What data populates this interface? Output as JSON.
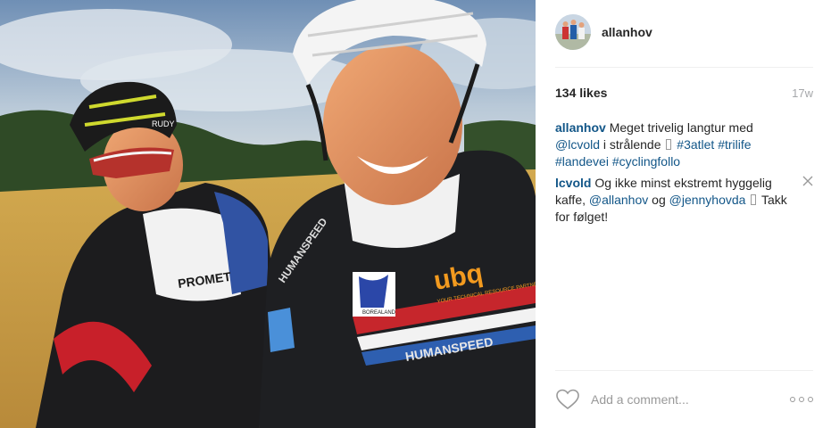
{
  "post": {
    "username": "allanhov",
    "likes": "134 likes",
    "age": "17w"
  },
  "caption": {
    "user": "allanhov",
    "text1": "Meget trivelig langtur med",
    "mention": "@lcvold",
    "text2": "i strålende",
    "tag1": "#3atlet",
    "tag2": "#trilife",
    "tag3": "#landevei",
    "tag4": "#cyclingfollo"
  },
  "comment": {
    "user": "lcvold",
    "text1": "Og ikke minst ekstremt hyggelig kaffe,",
    "mention1": "@allanhov",
    "text2": "og",
    "mention2": "@jennyhovda",
    "text3": "Takk for følget!"
  },
  "footer": {
    "placeholder": "Add a comment..."
  },
  "photo_text": {
    "helmet_brand": "RUDY",
    "jersey_left_1": "HUMANSPEED",
    "jersey_right_1": "ubq",
    "jersey_right_2": "YOUR TECHNICAL RESOURCE PARTNER",
    "jersey_right_3": "HUMANSPEED",
    "jersey_right_4": "BOREALAND",
    "jersey_left_2": "PROMET"
  },
  "colors": {
    "link": "#125688",
    "muted": "#a5a7aa",
    "divider": "#efefef"
  }
}
